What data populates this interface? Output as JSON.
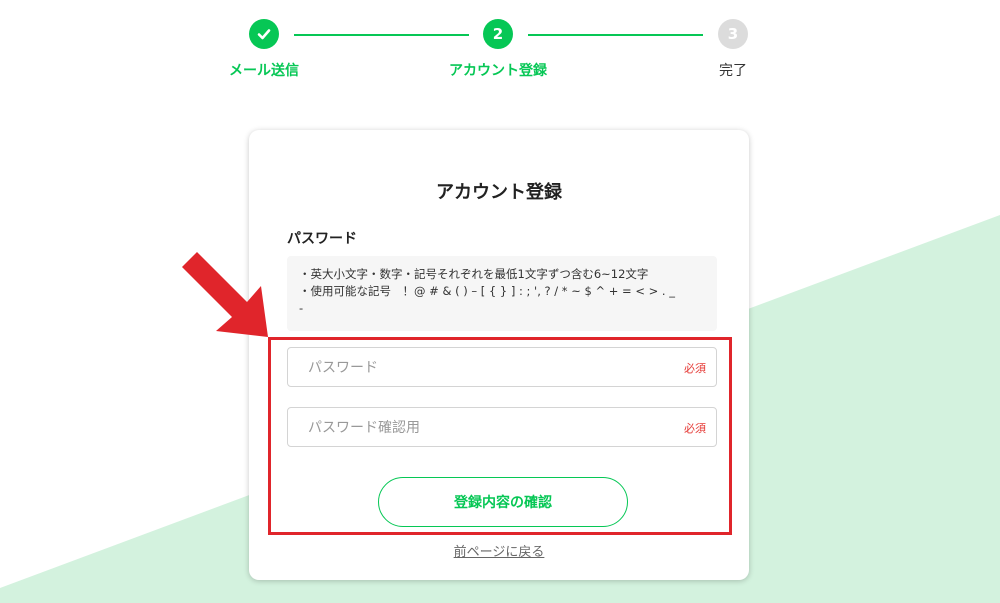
{
  "steps": [
    {
      "label": "メール送信",
      "state": "done",
      "icon": "check-icon"
    },
    {
      "label": "アカウント登録",
      "state": "active",
      "number": "2"
    },
    {
      "label": "完了",
      "state": "pending",
      "number": "3"
    }
  ],
  "card": {
    "title": "アカウント登録",
    "password_section_label": "パスワード",
    "rules": [
      "・英大小文字・数字・記号それぞれを最低1文字ずつ含む6~12文字",
      "・使用可能な記号　！@ # & ( ) – [ { } ] : ; ', ? / * ~ $ ^ + = < > . _",
      "-"
    ],
    "password_field": {
      "placeholder": "パスワード",
      "value": "",
      "required_label": "必須"
    },
    "password_confirm_field": {
      "placeholder": "パスワード確認用",
      "value": "",
      "required_label": "必須"
    },
    "confirm_button_label": "登録内容の確認",
    "back_link_label": "前ページに戻る"
  },
  "colors": {
    "accent": "#06c755",
    "background_triangle": "#d3f2de",
    "annotation": "#e0252b",
    "required": "#e53935"
  }
}
